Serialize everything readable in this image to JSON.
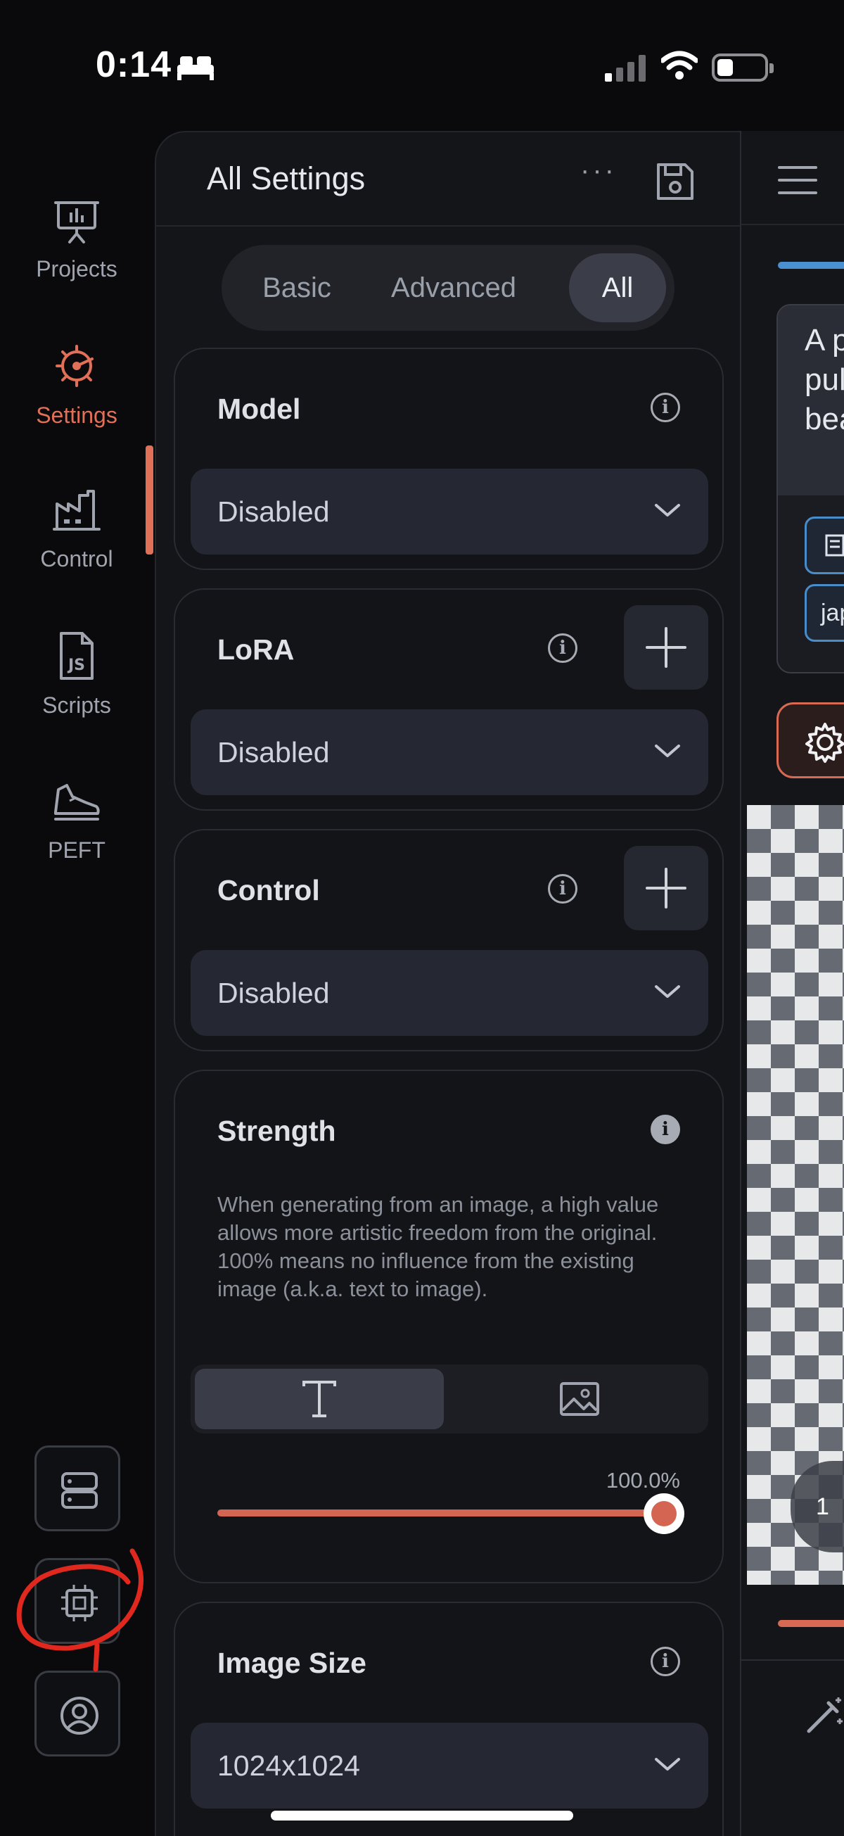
{
  "status_bar": {
    "time": "0:14"
  },
  "rail": {
    "items": [
      {
        "label": "Projects",
        "icon": "presentation-icon"
      },
      {
        "label": "Settings",
        "icon": "settings-icon",
        "active": true
      },
      {
        "label": "Control",
        "icon": "factory-icon"
      },
      {
        "label": "Scripts",
        "icon": "js-file-icon"
      },
      {
        "label": "PEFT",
        "icon": "sneaker-icon"
      }
    ],
    "bottom_buttons": [
      "server-icon",
      "cpu-chip-icon",
      "user-icon"
    ]
  },
  "panel": {
    "title": "All Settings",
    "more": "···",
    "tabs": [
      {
        "label": "Basic"
      },
      {
        "label": "Advanced"
      },
      {
        "label": "All",
        "selected": true
      }
    ]
  },
  "sections": {
    "model": {
      "title": "Model",
      "value": "Disabled"
    },
    "lora": {
      "title": "LoRA",
      "value": "Disabled"
    },
    "control": {
      "title": "Control",
      "value": "Disabled"
    },
    "strength": {
      "title": "Strength",
      "description": "When generating from an image, a high value allows more artistic freedom from the original. 100% means no influence from the existing image (a.k.a. text to image).",
      "value_label": "100.0%",
      "value": 1.0,
      "modes": [
        "text-mode-icon",
        "image-mode-icon"
      ]
    },
    "image_size": {
      "title": "Image Size",
      "value": "1024x1024"
    }
  },
  "canvas": {
    "prompt_text": "A p\npul\nbea",
    "chips": [
      "",
      "jap"
    ],
    "badge": "1"
  },
  "colors": {
    "accent": "#e07058",
    "blue": "#4a90d0",
    "annotation": "#e0281e"
  }
}
